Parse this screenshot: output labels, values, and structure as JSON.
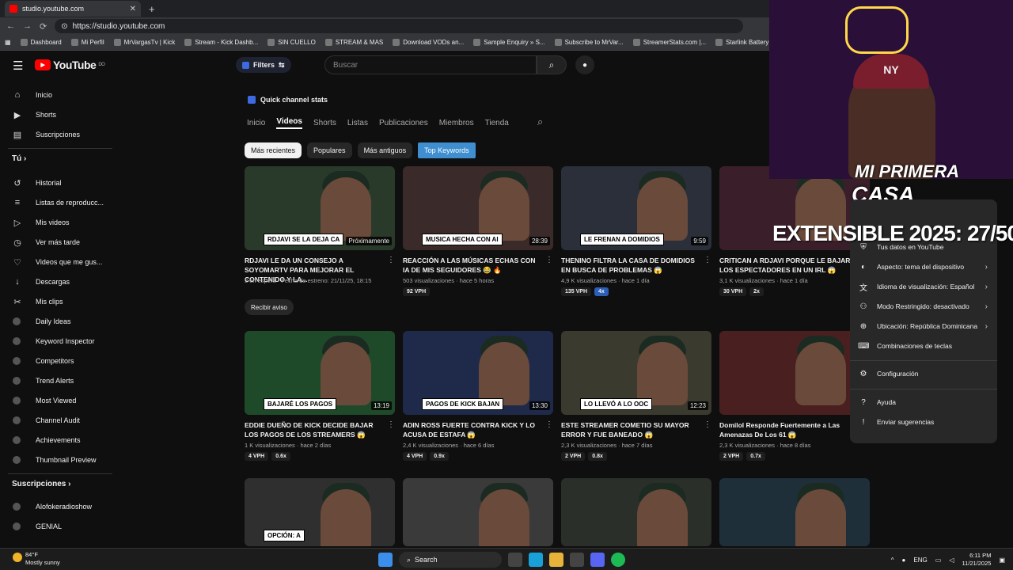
{
  "browser": {
    "tab_title": "studio.youtube.com",
    "url": "https://studio.youtube.com",
    "bookmarks": [
      "Dashboard",
      "Mi Perfil",
      "MrVargasTv | Kick",
      "Stream - Kick Dashb...",
      "SIN CUELLO",
      "STREAM & MAS",
      "Download VODs an...",
      "Sample Enquiry » S...",
      "Subscribe to MrVar...",
      "StreamerStats.com |...",
      "Starlink Battery Pow..."
    ]
  },
  "header": {
    "logo": "YouTube",
    "logo_region": "DO",
    "filters_label": "Filters",
    "search_placeholder": "Buscar"
  },
  "sidebar": {
    "main": [
      {
        "label": "Inicio",
        "icon": "home-icon"
      },
      {
        "label": "Shorts",
        "icon": "shorts-icon"
      },
      {
        "label": "Suscripciones",
        "icon": "subscriptions-icon"
      }
    ],
    "you_heading": "Tú",
    "you": [
      {
        "label": "Historial",
        "icon": "history-icon"
      },
      {
        "label": "Listas de reproducc...",
        "icon": "playlist-icon"
      },
      {
        "label": "Mis videos",
        "icon": "video-icon"
      },
      {
        "label": "Ver más tarde",
        "icon": "clock-icon"
      },
      {
        "label": "Videos que me gus...",
        "icon": "like-icon"
      },
      {
        "label": "Descargas",
        "icon": "download-icon"
      },
      {
        "label": "Mis clips",
        "icon": "scissors-icon"
      }
    ],
    "tools": [
      {
        "label": "Daily Ideas"
      },
      {
        "label": "Keyword Inspector"
      },
      {
        "label": "Competitors"
      },
      {
        "label": "Trend Alerts"
      },
      {
        "label": "Most Viewed"
      },
      {
        "label": "Channel Audit"
      },
      {
        "label": "Achievements"
      },
      {
        "label": "Thumbnail Preview"
      }
    ],
    "subs_heading": "Suscripciones",
    "subs": [
      {
        "label": "Alofokeradioshow"
      },
      {
        "label": "GENIAL"
      }
    ]
  },
  "main": {
    "quick_stats": "Quick channel stats",
    "tabs": [
      "Inicio",
      "Videos",
      "Shorts",
      "Listas",
      "Publicaciones",
      "Miembros",
      "Tienda"
    ],
    "chips": [
      "Más recientes",
      "Populares",
      "Más antiguos",
      "Top Keywords"
    ],
    "notify_label": "Recibir aviso",
    "videos": [
      {
        "caption": "RDJAVI SE LA DEJA CA",
        "duration": "Próximamente",
        "title": "RDJAVI LE DA UN CONSEJO A SOYOMARTV PARA MEJORAR EL CONTENIDO Y LA...",
        "meta": "2 en espera · Fecha de estreno: 21/11/25, 18:15",
        "badges": []
      },
      {
        "caption": "MUSICA HECHA CON AI",
        "duration": "28:39",
        "title": "REACCIÓN A LAS MÚSICAS ECHAS CON IA DE MIS SEGUIDORES 😂 🔥",
        "meta": "503 visualizaciones · hace 5 horas",
        "badges": [
          "92 VPH"
        ]
      },
      {
        "caption": "LE FRENAN A DOMIDIOS",
        "duration": "9:59",
        "title": "THENINO FILTRA LA CASA DE DOMIDIOS EN BUSCA DE PROBLEMAS 😱",
        "meta": "4,9 K visualizaciones · hace 1 día",
        "badges": [
          "135 VPH",
          "4x"
        ]
      },
      {
        "caption": "",
        "duration": "",
        "title": "CRITICAN A RDJAVI PORQUE LE BAJARO LOS ESPECTADORES EN UN IRL 😱",
        "meta": "3,1 K visualizaciones · hace 1 día",
        "badges": [
          "30 VPH",
          "2x"
        ]
      },
      {
        "caption": "BAJARÉ LOS PAGOS",
        "duration": "13:19",
        "title": "EDDIE DUEÑO DE KICK DECIDE BAJAR LOS PAGOS DE LOS STREAMERS 😱",
        "meta": "1 K visualizaciones · hace 2 días",
        "badges": [
          "4 VPH",
          "0.6x"
        ]
      },
      {
        "caption": "PAGOS DE KICK BAJAN",
        "duration": "13:30",
        "title": "ADIN ROSS FUERTE CONTRA KICK Y LO ACUSA DE ESTAFA 😱",
        "meta": "2,4 K visualizaciones · hace 6 días",
        "badges": [
          "4 VPH",
          "0.9x"
        ]
      },
      {
        "caption": "LO LLEVÓ A LO OOC",
        "duration": "12:23",
        "title": "ESTE STREAMER COMETIO SU MAYOR ERROR Y FUE BANEADO 😱",
        "meta": "2,3 K visualizaciones · hace 7 días",
        "badges": [
          "2 VPH",
          "0.8x"
        ]
      },
      {
        "caption": "",
        "duration": "",
        "title": "Domilol Responde Fuertemente a Las Amenazas De Los 61 😱",
        "meta": "2,3 K visualizaciones · hace 8 días",
        "badges": [
          "2 VPH",
          "0.7x"
        ]
      },
      {
        "caption": "OPCIÓN: A",
        "duration": "",
        "title": "",
        "meta": "",
        "badges": []
      },
      {
        "caption": "",
        "duration": "",
        "title": "",
        "meta": "",
        "badges": []
      },
      {
        "caption": "",
        "duration": "",
        "title": "",
        "meta": "",
        "badges": []
      },
      {
        "caption": "",
        "duration": "",
        "title": "",
        "meta": "",
        "badges": []
      }
    ]
  },
  "overlay": {
    "title_line1": "MI PRIMERA",
    "title_line2": "CASA",
    "extensible": "EXTENSIBLE 2025: 27/50",
    "hat_logo": "NY"
  },
  "menu": {
    "items": [
      {
        "label": "Tus datos en YouTube",
        "icon": "shield-icon",
        "arrow": false
      },
      {
        "label": "Aspecto: tema del dispositivo",
        "icon": "moon-icon",
        "arrow": true
      },
      {
        "label": "Idioma de visualización: Español",
        "icon": "translate-icon",
        "arrow": true
      },
      {
        "label": "Modo Restringido: desactivado",
        "icon": "restricted-icon",
        "arrow": true
      },
      {
        "label": "Ubicación: República Dominicana",
        "icon": "globe-icon",
        "arrow": true
      },
      {
        "label": "Combinaciones de teclas",
        "icon": "keyboard-icon",
        "arrow": false
      },
      {
        "label": "Configuración",
        "icon": "gear-icon",
        "arrow": false
      },
      {
        "label": "Ayuda",
        "icon": "help-icon",
        "arrow": false
      },
      {
        "label": "Enviar sugerencias",
        "icon": "feedback-icon",
        "arrow": false
      }
    ]
  },
  "taskbar": {
    "temp": "84°F",
    "weather": "Mostly sunny",
    "search": "Search",
    "lang": "ENG",
    "time": "6:11 PM",
    "date": "11/21/2025"
  }
}
